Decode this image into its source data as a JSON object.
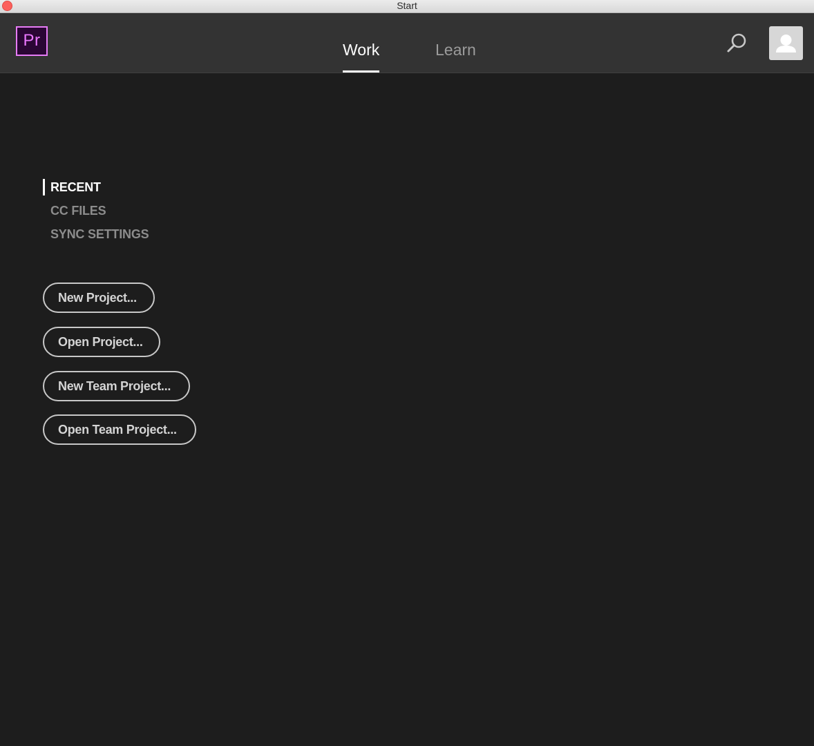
{
  "window": {
    "title": "Start"
  },
  "header": {
    "logo_text": "Pr",
    "tabs": [
      {
        "label": "Work",
        "active": true
      },
      {
        "label": "Learn",
        "active": false
      }
    ],
    "icons": {
      "search": "search-icon",
      "account": "user-avatar-icon"
    }
  },
  "sidebar": {
    "items": [
      {
        "label": "RECENT",
        "active": true
      },
      {
        "label": "CC FILES",
        "active": false
      },
      {
        "label": "SYNC SETTINGS",
        "active": false
      }
    ]
  },
  "actions": {
    "new_project": "New Project...",
    "open_project": "Open Project...",
    "new_team_project": "New Team Project...",
    "open_team_project": "Open Team Project..."
  },
  "colors": {
    "background": "#1d1d1d",
    "appbar": "#333333",
    "brand": "#ea77ff"
  }
}
